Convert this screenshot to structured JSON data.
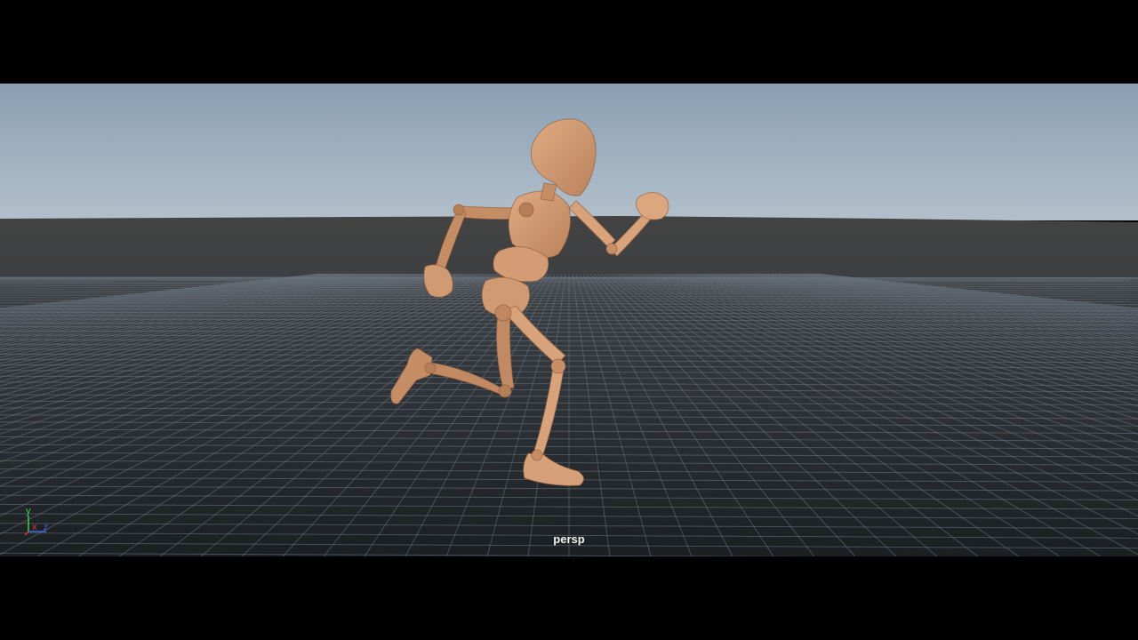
{
  "viewport": {
    "camera_label": "persp",
    "axis_labels": {
      "y": "y",
      "x": "x",
      "z": "z"
    },
    "colors": {
      "letterbox": "#000000",
      "sky_top": "#8a9fb3",
      "sky_bottom": "#b2bfcb",
      "ground_far": "#424242",
      "ground_near": "#1c2024",
      "grid_line": "#6b7580",
      "character_skin": "#d29b73",
      "character_shadow": "#a7714d",
      "axis_x": "#e53030",
      "axis_y": "#3fd13f",
      "axis_z": "#3f6de5"
    },
    "object": "rigged-character-running"
  }
}
